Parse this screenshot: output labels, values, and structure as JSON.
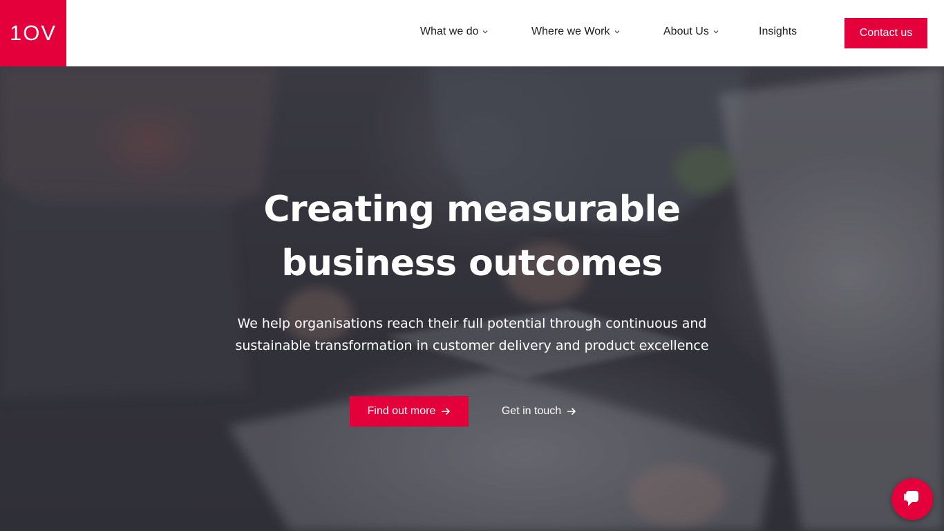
{
  "brand": {
    "logo_text": "1OV",
    "accent_color": "#e4003b"
  },
  "nav": {
    "items": [
      {
        "label": "What we do",
        "has_dropdown": true,
        "icon": "chevron-down-icon"
      },
      {
        "label": "Where we Work",
        "has_dropdown": true,
        "icon": "chevron-down-icon"
      },
      {
        "label": "About Us",
        "has_dropdown": true,
        "icon": "chevron-down-icon"
      },
      {
        "label": "Insights",
        "has_dropdown": false
      }
    ],
    "contact_label": "Contact us"
  },
  "hero": {
    "title_line1": "Creating measurable",
    "title_line2": "business outcomes",
    "subtitle_line1": "We help organisations reach their full potential through continuous and",
    "subtitle_line2": "sustainable transformation in customer delivery and product excellence",
    "primary_cta": {
      "label": "Find out more",
      "icon": "arrow-right-icon"
    },
    "secondary_cta": {
      "label": "Get in touch",
      "icon": "arrow-right-icon"
    }
  },
  "chat": {
    "icon": "chat-bubble-icon"
  }
}
